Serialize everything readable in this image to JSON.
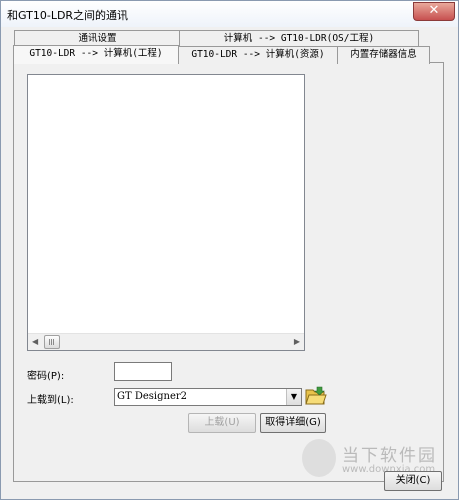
{
  "window": {
    "title": "和GT10-LDR之间的通讯",
    "close_glyph": "✕"
  },
  "tabs": {
    "row_back": [
      "通讯设置",
      "计算机 --> GT10-LDR(OS/工程)"
    ],
    "row_front": [
      "GT10-LDR --> 计算机(工程)",
      "GT10-LDR --> 计算机(资源)",
      "内置存储器信息"
    ],
    "active": "GT10-LDR --> 计算机(工程)"
  },
  "list": {
    "scroll_left_glyph": "◀",
    "scroll_right_glyph": "▶"
  },
  "password": {
    "label": "密码(P):",
    "value": ""
  },
  "upload_to": {
    "label": "上载到(L):",
    "selected": "GT Designer2",
    "dropdown_glyph": "▼",
    "browse_icon": "folder-open-icon"
  },
  "buttons": {
    "upload": "上载(U)",
    "get_details": "取得详细(G)",
    "close": "关闭(C)"
  },
  "watermark": {
    "text": "当下软件园",
    "url": "www.downxia.com"
  },
  "colors": {
    "border": "#999999",
    "background": "#f0f0f0",
    "disabled_text": "#a0a0a0"
  }
}
